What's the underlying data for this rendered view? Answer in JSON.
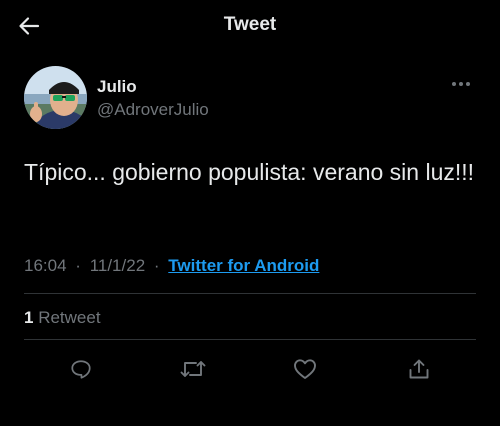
{
  "header": {
    "title": "Tweet",
    "back_icon": "arrow-left-icon"
  },
  "author": {
    "name": "Julio",
    "handle": "@AdroverJulio",
    "more_icon": "more-horizontal-icon"
  },
  "tweet": {
    "text": "Típico... gobierno populista: verano sin luz!!!"
  },
  "meta": {
    "time": "16:04",
    "date": "11/1/22",
    "separator": "·",
    "source": "Twitter for Android"
  },
  "stats": {
    "retweet_count": "1",
    "retweet_label": "Retweet"
  },
  "actions": [
    {
      "name": "reply",
      "icon": "reply-icon"
    },
    {
      "name": "retweet",
      "icon": "retweet-icon"
    },
    {
      "name": "like",
      "icon": "heart-icon"
    },
    {
      "name": "share",
      "icon": "share-icon"
    }
  ],
  "colors": {
    "background": "#000000",
    "text_primary": "#e7e9ea",
    "text_secondary": "#71767b",
    "link": "#1d9bf0",
    "divider": "#2f3336"
  }
}
